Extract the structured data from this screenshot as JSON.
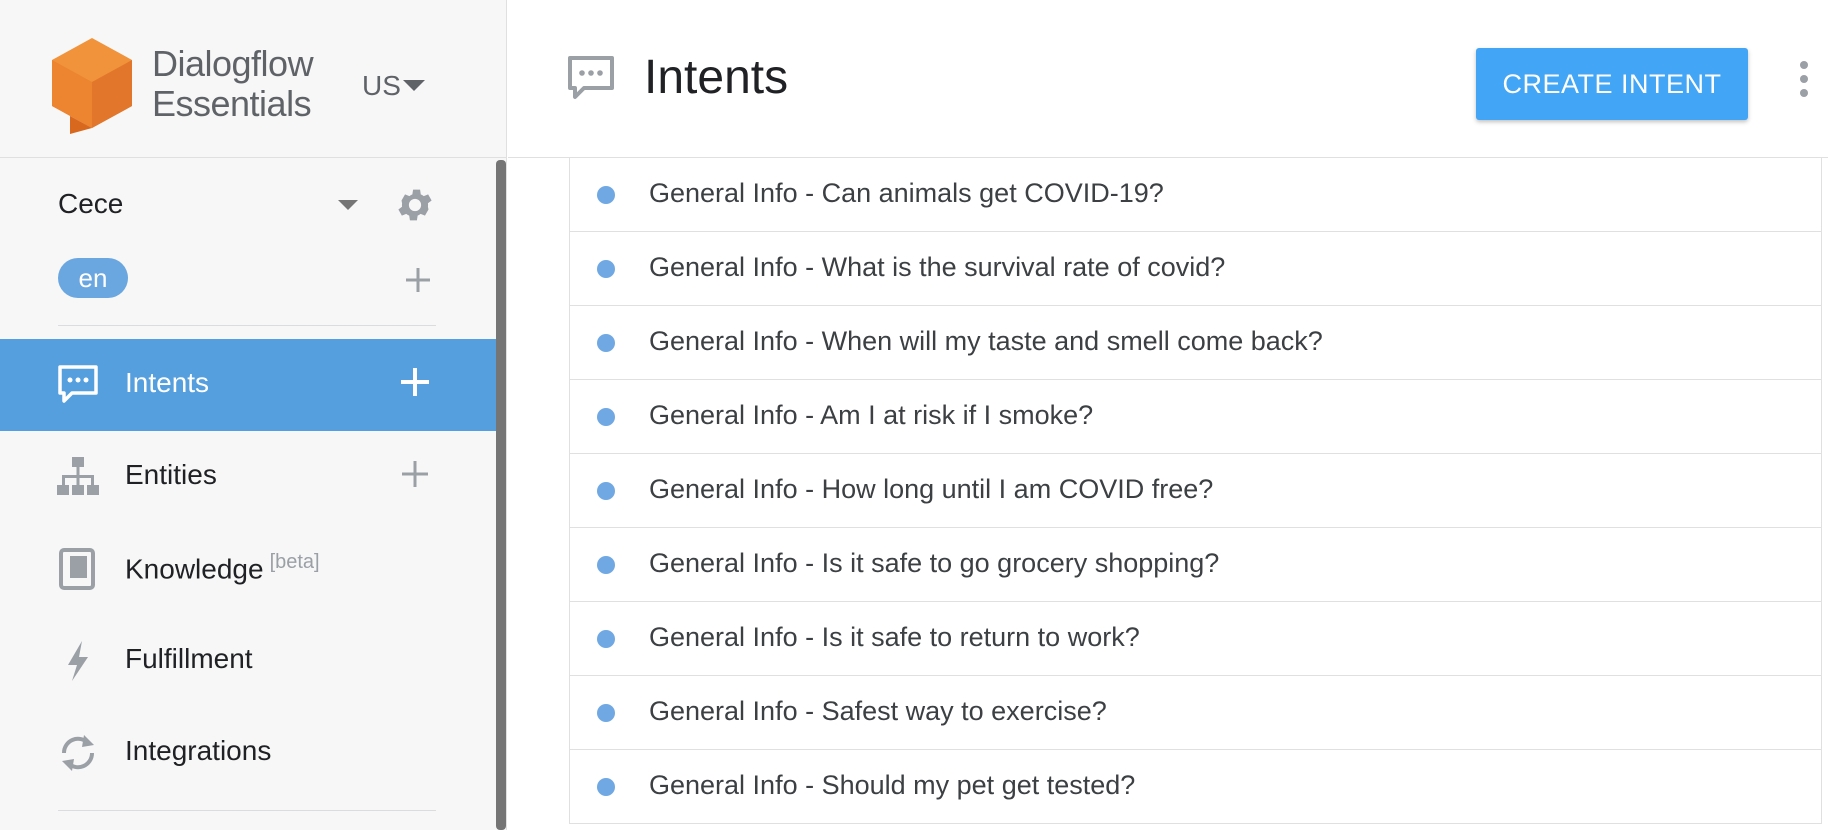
{
  "app": {
    "logo_line1": "Dialogflow",
    "logo_line2": "Essentials",
    "region": "US"
  },
  "agent": {
    "name": "Cece",
    "language": "en"
  },
  "nav": {
    "items": [
      {
        "label": "Intents",
        "icon": "intents-icon",
        "active": true
      },
      {
        "label": "Entities",
        "icon": "entities-icon",
        "active": false
      },
      {
        "label": "Knowledge",
        "badge": "[beta]",
        "icon": "knowledge-icon",
        "active": false
      },
      {
        "label": "Fulfillment",
        "icon": "fulfillment-icon",
        "active": false
      },
      {
        "label": "Integrations",
        "icon": "integrations-icon",
        "active": false
      }
    ]
  },
  "header": {
    "title": "Intents",
    "create_button": "CREATE INTENT"
  },
  "intents": [
    "General Info - Can animals get COVID-19?",
    "General Info - What is the survival rate of covid?",
    "General Info - When will my taste and smell come back?",
    "General Info - Am I at risk if I smoke?",
    "General Info - How long until I am COVID free?",
    "General Info - Is it safe to go grocery shopping?",
    "General Info - Is it safe to return to work?",
    "General Info - Safest way to exercise?",
    "General Info - Should my pet get tested?"
  ],
  "colors": {
    "accent": "#569fde",
    "button": "#42a5f5",
    "logo_orange": "#ef8c34"
  }
}
